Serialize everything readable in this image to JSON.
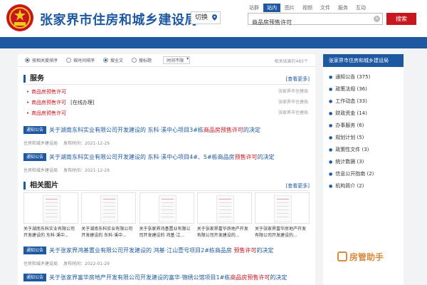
{
  "header": {
    "site_title": "张家界市住房和城乡建设局",
    "switch_label": "切换",
    "scope_tabs": [
      "站群",
      "站内",
      "图片",
      "视频",
      "文件",
      "服务",
      "互动"
    ],
    "search_value": "商品房预售许可",
    "search_button": "搜索",
    "colors": {
      "primary": "#1d58a0",
      "search_button": "#c8161e"
    }
  },
  "filters": {
    "sort_relevance": "按相关度排序",
    "sort_time": "按时间排序",
    "scope_fulltext": "搜全文",
    "scope_title": "搜标题",
    "time_limit": "时间不限",
    "result_count": "相关结果约485个"
  },
  "service": {
    "title": "服务",
    "more": "[查看更多]",
    "items": [
      {
        "label": "商品房预售许可",
        "extra": "",
        "org": "张家界市住建局"
      },
      {
        "label": "商品房预售许可",
        "extra": "[在线办理]",
        "org": "张家界市住建局"
      },
      {
        "label": "商品房预售许可",
        "extra": "",
        "org": "张家界市住建局"
      }
    ]
  },
  "news": [
    {
      "badge": "通知公告",
      "title_pre": "关于湖南东科实业有限公司开发建设的 东科·溪中心项目3#栋",
      "title_hl": "商品房预售许可",
      "title_post": "的决定",
      "source": "住房和城乡建设局",
      "date": "发布时间：2021-12-29"
    },
    {
      "badge": "通知公告",
      "title_pre": "关于湖南东科实业有限公司开发建设的 东科·溪中心项目4#、5#栋商品房",
      "title_hl": "预售许可",
      "title_post": "的决定",
      "source": "住房和城乡建设局",
      "date": "发布时间：2021-12-29"
    },
    {
      "badge": "通知公告",
      "title_pre": "关于张家界鸿基置业有限公司开发建设的 鸿基·江山壹号项目2#栋商品房 ",
      "title_hl": "预售许可",
      "title_post": "的决定",
      "source": "住房和城乡建设局",
      "date": "发布时间：2022-01-29"
    },
    {
      "badge": "通知公告",
      "title_pre": "关于张家界富华房地产开发有限公司开发建设的富华·锦绣公馆项目1#栋",
      "title_hl": "商品房预售许可",
      "title_post": "的决定",
      "source": "",
      "date": ""
    }
  ],
  "pictures": {
    "title": "相关图片",
    "more": "[查看更多]",
    "items": [
      "关于湖南东科实业有限公司开发建设的 东科·溪中...",
      "关于湖南东科实业有限公司开发建设的 东科·溪中...",
      "关于张家界鸿基置业有限公司开发建设的 鸿基·江...",
      "关于张家界富华房地产开发有限公司开发建设的...",
      "关于张家界富华房地产开发有限公司开发建设的..."
    ]
  },
  "sidebar": {
    "title": "张家界市住房和城乡建设局",
    "items": [
      {
        "label": "通知公告",
        "count": "(375)"
      },
      {
        "label": "政策法规",
        "count": "(36)"
      },
      {
        "label": "工作动态",
        "count": "(33)"
      },
      {
        "label": "财政资金",
        "count": "(14)"
      },
      {
        "label": "办事服务",
        "count": "(6)"
      },
      {
        "label": "规划计划",
        "count": "(5)"
      },
      {
        "label": "政策性文件",
        "count": "(3)"
      },
      {
        "label": "统计数据",
        "count": "(3)"
      },
      {
        "label": "信息公开指南",
        "count": "(2)"
      },
      {
        "label": "机构简介",
        "count": "(2)"
      }
    ]
  },
  "watermark": "房管助手"
}
